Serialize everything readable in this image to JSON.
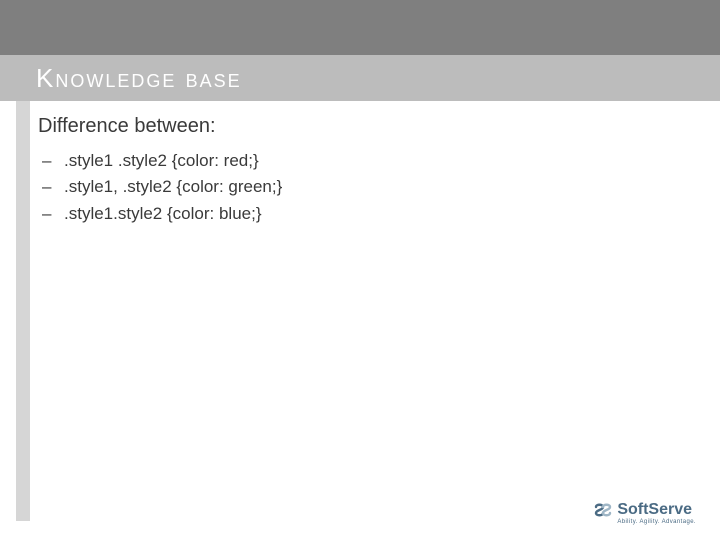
{
  "title": "Knowledge base",
  "heading": "Difference between:",
  "items": [
    ".style1 .style2 {color: red;}",
    ".style1, .style2 {color: green;}",
    ".style1.style2 {color: blue;}"
  ],
  "logo": {
    "name": "SoftServe",
    "tagline": "Ability. Agility. Advantage."
  }
}
